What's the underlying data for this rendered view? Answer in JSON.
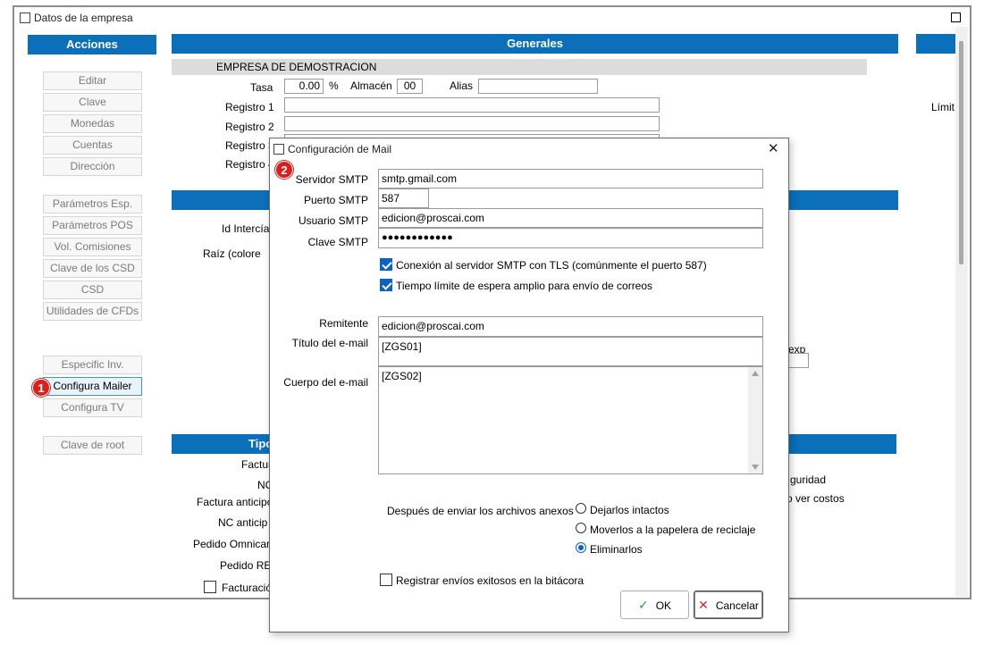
{
  "window": {
    "title": "Datos de la empresa"
  },
  "acciones": {
    "header": "Acciones",
    "buttons": [
      "Editar",
      "Clave",
      "Monedas",
      "Cuentas",
      "Dirección",
      "Parámetros Esp.",
      "Parámetros POS",
      "Vol. Comisiones",
      "Clave de los CSD",
      "CSD",
      "Utilidades de CFDs",
      "Especific Inv.",
      "Configura Mailer",
      "Configura TV",
      "Clave de root"
    ]
  },
  "generales": {
    "header": "Generales",
    "company_name": "EMPRESA DE DEMOSTRACION",
    "tasa_label": "Tasa",
    "tasa_value": "0.00",
    "percent": "%",
    "almacen_label": "Almacén",
    "almacen_value": "00",
    "alias_label": "Alias",
    "registro_1": "Registro 1",
    "registro_2": "Registro 2",
    "registro_3": "Registro 3",
    "registro_4": "Registro 4",
    "id_intercia": "Id Intercía",
    "raiz": "Raíz (colore",
    "limit": "Límit",
    "exp": "exp"
  },
  "tipo": {
    "header": "Tipo",
    "factura": "Factura",
    "nc": "NC",
    "factura_anticipo": "Factura anticipo",
    "nc_anticipo": "NC anticip",
    "pedido_omnicanal": "Pedido Omnicar",
    "pedido_rel": "Pedido REI",
    "facturacion": "Facturació",
    "seguridad": "guridad",
    "ver_costos": "o ver costos"
  },
  "badges": {
    "one": "1",
    "two": "2"
  },
  "dialog": {
    "title": "Configuración de Mail",
    "servidor_label": "Servidor SMTP",
    "servidor_value": "smtp.gmail.com",
    "puerto_label": "Puerto SMTP",
    "puerto_value": "587",
    "usuario_label": "Usuario SMTP",
    "usuario_value": "edicion@proscai.com",
    "clave_label": "Clave SMTP",
    "clave_value": "●●●●●●●●●●●●",
    "tls_label": "Conexión al servidor SMTP con TLS (comúnmente el puerto 587)",
    "timeout_label": "Tiempo límite de espera amplio para envío de correos",
    "remitente_label": "Remitente",
    "remitente_value": "edicion@proscai.com",
    "titulo_label": "Título del e-mail",
    "titulo_value": "[ZGS01]",
    "cuerpo_label": "Cuerpo del e-mail",
    "cuerpo_value": "[ZGS02]",
    "despues_label": "Después de enviar los archivos anexos",
    "radio_intactos": "Dejarlos intactos",
    "radio_papelera": "Moverlos a la papelera de reciclaje",
    "radio_eliminar": "Eliminarlos",
    "registrar_label": "Registrar envíos exitosos en la bitácora",
    "ok_label": "OK",
    "cancel_label": "Cancelar",
    "close_glyph": "✕"
  }
}
